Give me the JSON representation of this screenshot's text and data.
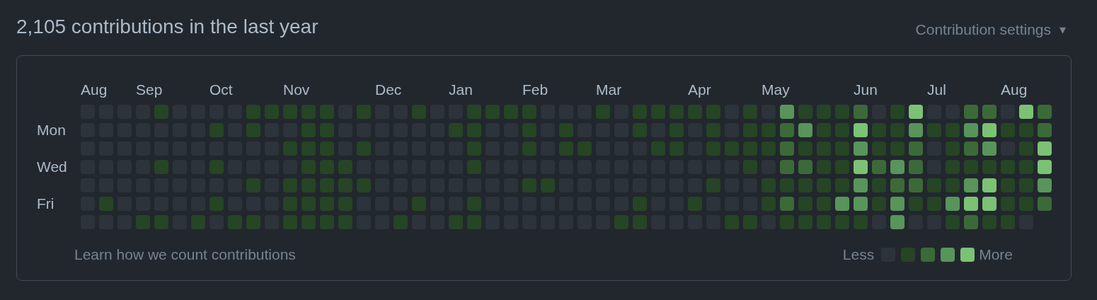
{
  "title": "2,105 contributions in the last year",
  "settings": {
    "label": "Contribution settings",
    "caret": "▾"
  },
  "graph": {
    "day_labels": [
      "Mon",
      "Wed",
      "Fri"
    ],
    "weeks": [
      {
        "month": "Aug",
        "days": [
          {
            "color": "#2d333b"
          },
          {
            "color": "#2d333b"
          },
          {
            "color": "#2d333b"
          },
          {
            "color": "#2d333b"
          },
          {
            "color": "#2d333b"
          },
          {
            "color": "#2d333b"
          },
          {
            "color": "#2d333b"
          }
        ]
      },
      {
        "days": [
          {
            "color": "#2d333b"
          },
          {
            "color": "#2d333b"
          },
          {
            "color": "#2d333b"
          },
          {
            "color": "#2d333b"
          },
          {
            "color": "#2d333b"
          },
          {
            "color": "#254525"
          },
          {
            "color": "#2d333b"
          }
        ]
      },
      {
        "days": [
          {
            "color": "#2d333b"
          },
          {
            "color": "#2d333b"
          },
          {
            "color": "#2d333b"
          },
          {
            "color": "#2d333b"
          },
          {
            "color": "#2d333b"
          },
          {
            "color": "#2d333b"
          },
          {
            "color": "#2d333b"
          }
        ]
      },
      {
        "month": "Sep",
        "days": [
          {
            "color": "#2d333b"
          },
          {
            "color": "#2d333b"
          },
          {
            "color": "#2d333b"
          },
          {
            "color": "#2d333b"
          },
          {
            "color": "#2d333b"
          },
          {
            "color": "#2d333b"
          },
          {
            "color": "#254525"
          }
        ]
      },
      {
        "days": [
          {
            "color": "#254525"
          },
          {
            "color": "#2d333b"
          },
          {
            "color": "#2d333b"
          },
          {
            "color": "#254525"
          },
          {
            "color": "#2d333b"
          },
          {
            "color": "#2d333b"
          },
          {
            "color": "#254525"
          }
        ]
      },
      {
        "days": [
          {
            "color": "#2d333b"
          },
          {
            "color": "#2d333b"
          },
          {
            "color": "#2d333b"
          },
          {
            "color": "#2d333b"
          },
          {
            "color": "#2d333b"
          },
          {
            "color": "#2d333b"
          },
          {
            "color": "#2d333b"
          }
        ]
      },
      {
        "days": [
          {
            "color": "#2d333b"
          },
          {
            "color": "#2d333b"
          },
          {
            "color": "#2d333b"
          },
          {
            "color": "#2d333b"
          },
          {
            "color": "#2d333b"
          },
          {
            "color": "#2d333b"
          },
          {
            "color": "#254525"
          }
        ]
      },
      {
        "month": "Oct",
        "days": [
          {
            "color": "#2d333b"
          },
          {
            "color": "#254525"
          },
          {
            "color": "#2d333b"
          },
          {
            "color": "#254525"
          },
          {
            "color": "#2d333b"
          },
          {
            "color": "#254525"
          },
          {
            "color": "#2d333b"
          }
        ]
      },
      {
        "days": [
          {
            "color": "#2d333b"
          },
          {
            "color": "#2d333b"
          },
          {
            "color": "#2d333b"
          },
          {
            "color": "#2d333b"
          },
          {
            "color": "#2d333b"
          },
          {
            "color": "#2d333b"
          },
          {
            "color": "#254525"
          }
        ]
      },
      {
        "days": [
          {
            "color": "#254525"
          },
          {
            "color": "#254525"
          },
          {
            "color": "#2d333b"
          },
          {
            "color": "#2d333b"
          },
          {
            "color": "#254525"
          },
          {
            "color": "#2d333b"
          },
          {
            "color": "#254525"
          }
        ]
      },
      {
        "days": [
          {
            "color": "#254525"
          },
          {
            "color": "#2d333b"
          },
          {
            "color": "#2d333b"
          },
          {
            "color": "#2d333b"
          },
          {
            "color": "#2d333b"
          },
          {
            "color": "#2d333b"
          },
          {
            "color": "#2d333b"
          }
        ]
      },
      {
        "month": "Nov",
        "days": [
          {
            "color": "#254525"
          },
          {
            "color": "#2d333b"
          },
          {
            "color": "#254525"
          },
          {
            "color": "#2d333b"
          },
          {
            "color": "#254525"
          },
          {
            "color": "#254525"
          },
          {
            "color": "#254525"
          }
        ]
      },
      {
        "days": [
          {
            "color": "#254525"
          },
          {
            "color": "#254525"
          },
          {
            "color": "#254525"
          },
          {
            "color": "#254525"
          },
          {
            "color": "#254525"
          },
          {
            "color": "#254525"
          },
          {
            "color": "#254525"
          }
        ]
      },
      {
        "days": [
          {
            "color": "#254525"
          },
          {
            "color": "#254525"
          },
          {
            "color": "#254525"
          },
          {
            "color": "#254525"
          },
          {
            "color": "#254525"
          },
          {
            "color": "#254525"
          },
          {
            "color": "#254525"
          }
        ]
      },
      {
        "days": [
          {
            "color": "#2d333b"
          },
          {
            "color": "#2d333b"
          },
          {
            "color": "#2d333b"
          },
          {
            "color": "#254525"
          },
          {
            "color": "#254525"
          },
          {
            "color": "#254525"
          },
          {
            "color": "#254525"
          }
        ]
      },
      {
        "days": [
          {
            "color": "#254525"
          },
          {
            "color": "#2d333b"
          },
          {
            "color": "#254525"
          },
          {
            "color": "#2d333b"
          },
          {
            "color": "#254525"
          },
          {
            "color": "#2d333b"
          },
          {
            "color": "#2d333b"
          }
        ]
      },
      {
        "month": "Dec",
        "days": [
          {
            "color": "#2d333b"
          },
          {
            "color": "#2d333b"
          },
          {
            "color": "#2d333b"
          },
          {
            "color": "#2d333b"
          },
          {
            "color": "#2d333b"
          },
          {
            "color": "#2d333b"
          },
          {
            "color": "#2d333b"
          }
        ]
      },
      {
        "days": [
          {
            "color": "#2d333b"
          },
          {
            "color": "#2d333b"
          },
          {
            "color": "#2d333b"
          },
          {
            "color": "#2d333b"
          },
          {
            "color": "#2d333b"
          },
          {
            "color": "#2d333b"
          },
          {
            "color": "#254525"
          }
        ]
      },
      {
        "days": [
          {
            "color": "#254525"
          },
          {
            "color": "#2d333b"
          },
          {
            "color": "#2d333b"
          },
          {
            "color": "#2d333b"
          },
          {
            "color": "#2d333b"
          },
          {
            "color": "#254525"
          },
          {
            "color": "#2d333b"
          }
        ]
      },
      {
        "days": [
          {
            "color": "#2d333b"
          },
          {
            "color": "#2d333b"
          },
          {
            "color": "#2d333b"
          },
          {
            "color": "#2d333b"
          },
          {
            "color": "#2d333b"
          },
          {
            "color": "#2d333b"
          },
          {
            "color": "#2d333b"
          }
        ]
      },
      {
        "month": "Jan",
        "days": [
          {
            "color": "#2d333b"
          },
          {
            "color": "#254525"
          },
          {
            "color": "#2d333b"
          },
          {
            "color": "#2d333b"
          },
          {
            "color": "#2d333b"
          },
          {
            "color": "#2d333b"
          },
          {
            "color": "#254525"
          }
        ]
      },
      {
        "days": [
          {
            "color": "#254525"
          },
          {
            "color": "#254525"
          },
          {
            "color": "#254525"
          },
          {
            "color": "#254525"
          },
          {
            "color": "#2d333b"
          },
          {
            "color": "#254525"
          },
          {
            "color": "#254525"
          }
        ]
      },
      {
        "days": [
          {
            "color": "#254525"
          },
          {
            "color": "#2d333b"
          },
          {
            "color": "#2d333b"
          },
          {
            "color": "#2d333b"
          },
          {
            "color": "#2d333b"
          },
          {
            "color": "#2d333b"
          },
          {
            "color": "#2d333b"
          }
        ]
      },
      {
        "days": [
          {
            "color": "#254525"
          },
          {
            "color": "#2d333b"
          },
          {
            "color": "#2d333b"
          },
          {
            "color": "#2d333b"
          },
          {
            "color": "#2d333b"
          },
          {
            "color": "#2d333b"
          },
          {
            "color": "#2d333b"
          }
        ]
      },
      {
        "month": "Feb",
        "days": [
          {
            "color": "#254525"
          },
          {
            "color": "#254525"
          },
          {
            "color": "#254525"
          },
          {
            "color": "#2d333b"
          },
          {
            "color": "#254525"
          },
          {
            "color": "#2d333b"
          },
          {
            "color": "#2d333b"
          }
        ]
      },
      {
        "days": [
          {
            "color": "#2d333b"
          },
          {
            "color": "#2d333b"
          },
          {
            "color": "#2d333b"
          },
          {
            "color": "#2d333b"
          },
          {
            "color": "#254525"
          },
          {
            "color": "#2d333b"
          },
          {
            "color": "#2d333b"
          }
        ]
      },
      {
        "days": [
          {
            "color": "#2d333b"
          },
          {
            "color": "#254525"
          },
          {
            "color": "#254525"
          },
          {
            "color": "#2d333b"
          },
          {
            "color": "#2d333b"
          },
          {
            "color": "#2d333b"
          },
          {
            "color": "#2d333b"
          }
        ]
      },
      {
        "days": [
          {
            "color": "#2d333b"
          },
          {
            "color": "#2d333b"
          },
          {
            "color": "#254525"
          },
          {
            "color": "#2d333b"
          },
          {
            "color": "#2d333b"
          },
          {
            "color": "#2d333b"
          },
          {
            "color": "#2d333b"
          }
        ]
      },
      {
        "month": "Mar",
        "days": [
          {
            "color": "#254525"
          },
          {
            "color": "#2d333b"
          },
          {
            "color": "#2d333b"
          },
          {
            "color": "#2d333b"
          },
          {
            "color": "#2d333b"
          },
          {
            "color": "#2d333b"
          },
          {
            "color": "#2d333b"
          }
        ]
      },
      {
        "days": [
          {
            "color": "#2d333b"
          },
          {
            "color": "#2d333b"
          },
          {
            "color": "#2d333b"
          },
          {
            "color": "#2d333b"
          },
          {
            "color": "#2d333b"
          },
          {
            "color": "#2d333b"
          },
          {
            "color": "#254525"
          }
        ]
      },
      {
        "days": [
          {
            "color": "#254525"
          },
          {
            "color": "#254525"
          },
          {
            "color": "#2d333b"
          },
          {
            "color": "#2d333b"
          },
          {
            "color": "#2d333b"
          },
          {
            "color": "#254525"
          },
          {
            "color": "#254525"
          }
        ]
      },
      {
        "days": [
          {
            "color": "#254525"
          },
          {
            "color": "#2d333b"
          },
          {
            "color": "#254525"
          },
          {
            "color": "#2d333b"
          },
          {
            "color": "#2d333b"
          },
          {
            "color": "#2d333b"
          },
          {
            "color": "#2d333b"
          }
        ]
      },
      {
        "days": [
          {
            "color": "#254525"
          },
          {
            "color": "#254525"
          },
          {
            "color": "#254525"
          },
          {
            "color": "#2d333b"
          },
          {
            "color": "#2d333b"
          },
          {
            "color": "#2d333b"
          },
          {
            "color": "#2d333b"
          }
        ]
      },
      {
        "month": "Apr",
        "days": [
          {
            "color": "#254525"
          },
          {
            "color": "#2d333b"
          },
          {
            "color": "#2d333b"
          },
          {
            "color": "#2d333b"
          },
          {
            "color": "#2d333b"
          },
          {
            "color": "#254525"
          },
          {
            "color": "#2d333b"
          }
        ]
      },
      {
        "days": [
          {
            "color": "#254525"
          },
          {
            "color": "#254525"
          },
          {
            "color": "#254525"
          },
          {
            "color": "#2d333b"
          },
          {
            "color": "#254525"
          },
          {
            "color": "#2d333b"
          },
          {
            "color": "#2d333b"
          }
        ]
      },
      {
        "days": [
          {
            "color": "#2d333b"
          },
          {
            "color": "#2d333b"
          },
          {
            "color": "#254525"
          },
          {
            "color": "#2d333b"
          },
          {
            "color": "#2d333b"
          },
          {
            "color": "#2d333b"
          },
          {
            "color": "#254525"
          }
        ]
      },
      {
        "days": [
          {
            "color": "#254525"
          },
          {
            "color": "#254525"
          },
          {
            "color": "#254525"
          },
          {
            "color": "#254525"
          },
          {
            "color": "#2d333b"
          },
          {
            "color": "#2d333b"
          },
          {
            "color": "#254525"
          }
        ]
      },
      {
        "month": "May",
        "days": [
          {
            "color": "#2d333b"
          },
          {
            "color": "#254525"
          },
          {
            "color": "#254525"
          },
          {
            "color": "#2d333b"
          },
          {
            "color": "#254525"
          },
          {
            "color": "#254525"
          },
          {
            "color": "#2d333b"
          }
        ]
      },
      {
        "days": [
          {
            "color": "#58955a"
          },
          {
            "color": "#3b6a38"
          },
          {
            "color": "#3b6a38"
          },
          {
            "color": "#3b6a38"
          },
          {
            "color": "#254525"
          },
          {
            "color": "#3b6a38"
          },
          {
            "color": "#254525"
          }
        ]
      },
      {
        "days": [
          {
            "color": "#254525"
          },
          {
            "color": "#58955a"
          },
          {
            "color": "#254525"
          },
          {
            "color": "#3b6a38"
          },
          {
            "color": "#254525"
          },
          {
            "color": "#254525"
          },
          {
            "color": "#254525"
          }
        ]
      },
      {
        "days": [
          {
            "color": "#254525"
          },
          {
            "color": "#254525"
          },
          {
            "color": "#254525"
          },
          {
            "color": "#254525"
          },
          {
            "color": "#254525"
          },
          {
            "color": "#254525"
          },
          {
            "color": "#254525"
          }
        ]
      },
      {
        "days": [
          {
            "color": "#254525"
          },
          {
            "color": "#254525"
          },
          {
            "color": "#254525"
          },
          {
            "color": "#254525"
          },
          {
            "color": "#254525"
          },
          {
            "color": "#58955a"
          },
          {
            "color": "#254525"
          }
        ]
      },
      {
        "month": "Jun",
        "days": [
          {
            "color": "#3b6a38"
          },
          {
            "color": "#7cc274"
          },
          {
            "color": "#58955a"
          },
          {
            "color": "#7cc274"
          },
          {
            "color": "#58955a"
          },
          {
            "color": "#58955a"
          },
          {
            "color": "#254525"
          }
        ]
      },
      {
        "days": [
          {
            "color": "#2d333b"
          },
          {
            "color": "#254525"
          },
          {
            "color": "#254525"
          },
          {
            "color": "#3b6a38"
          },
          {
            "color": "#254525"
          },
          {
            "color": "#254525"
          },
          {
            "color": "#2d333b"
          }
        ]
      },
      {
        "days": [
          {
            "color": "#254525"
          },
          {
            "color": "#254525"
          },
          {
            "color": "#254525"
          },
          {
            "color": "#58955a"
          },
          {
            "color": "#3b6a38"
          },
          {
            "color": "#58955a"
          },
          {
            "color": "#58955a"
          }
        ]
      },
      {
        "days": [
          {
            "color": "#7cc274"
          },
          {
            "color": "#58955a"
          },
          {
            "color": "#3b6a38"
          },
          {
            "color": "#3b6a38"
          },
          {
            "color": "#3b6a38"
          },
          {
            "color": "#254525"
          },
          {
            "color": "#2d333b"
          }
        ]
      },
      {
        "month": "Jul",
        "days": [
          {
            "color": "#2d333b"
          },
          {
            "color": "#254525"
          },
          {
            "color": "#2d333b"
          },
          {
            "color": "#2d333b"
          },
          {
            "color": "#254525"
          },
          {
            "color": "#254525"
          },
          {
            "color": "#2d333b"
          }
        ]
      },
      {
        "days": [
          {
            "color": "#2d333b"
          },
          {
            "color": "#254525"
          },
          {
            "color": "#254525"
          },
          {
            "color": "#254525"
          },
          {
            "color": "#254525"
          },
          {
            "color": "#58955a"
          },
          {
            "color": "#254525"
          }
        ]
      },
      {
        "days": [
          {
            "color": "#3b6a38"
          },
          {
            "color": "#58955a"
          },
          {
            "color": "#3b6a38"
          },
          {
            "color": "#254525"
          },
          {
            "color": "#58955a"
          },
          {
            "color": "#7cc274"
          },
          {
            "color": "#3b6a38"
          }
        ]
      },
      {
        "days": [
          {
            "color": "#3b6a38"
          },
          {
            "color": "#7cc274"
          },
          {
            "color": "#58955a"
          },
          {
            "color": "#254525"
          },
          {
            "color": "#7cc274"
          },
          {
            "color": "#7cc274"
          },
          {
            "color": "#254525"
          }
        ]
      },
      {
        "month": "Aug",
        "days": [
          {
            "color": "#2d333b"
          },
          {
            "color": "#254525"
          },
          {
            "color": "#2d333b"
          },
          {
            "color": "#254525"
          },
          {
            "color": "#254525"
          },
          {
            "color": "#254525"
          },
          {
            "color": "#254525"
          }
        ]
      },
      {
        "days": [
          {
            "color": "#7cc274"
          },
          {
            "color": "#254525"
          },
          {
            "color": "#254525"
          },
          {
            "color": "#254525"
          },
          {
            "color": "#254525"
          },
          {
            "color": "#254525"
          },
          {
            "color": "#2d333b"
          }
        ]
      },
      {
        "days": [
          {
            "color": "#3b6a38"
          },
          {
            "color": "#3b6a38"
          },
          {
            "color": "#7cc274"
          },
          {
            "color": "#7cc274"
          },
          {
            "color": "#58955a"
          },
          {
            "color": "#3b6a38"
          }
        ]
      }
    ]
  },
  "footer": {
    "link": "Learn how we count contributions",
    "legend": {
      "less": "Less",
      "more": "More",
      "swatches": [
        {
          "color": "#2d333b"
        },
        {
          "color": "#254525"
        },
        {
          "color": "#3b6a38"
        },
        {
          "color": "#58955a"
        },
        {
          "color": "#7cc274"
        }
      ]
    }
  }
}
